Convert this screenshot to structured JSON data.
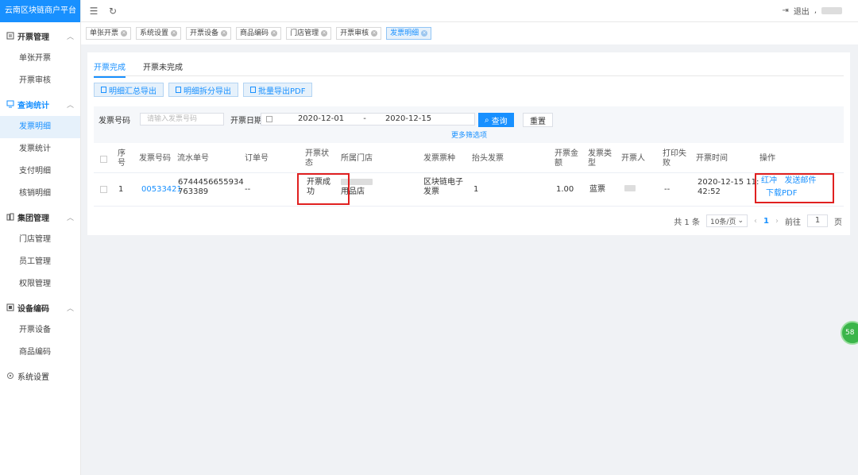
{
  "app": {
    "title": "云南区块链商户平台"
  },
  "sidebar": {
    "groups": [
      {
        "label": "开票管理",
        "icon": "invoice-icon",
        "items": [
          "单张开票",
          "开票审核"
        ]
      },
      {
        "label": "查询统计",
        "icon": "chart-icon",
        "items": [
          "发票明细",
          "发票统计",
          "支付明细",
          "核销明细"
        ],
        "active_item": "发票明细"
      },
      {
        "label": "集团管理",
        "icon": "group-icon",
        "items": [
          "门店管理",
          "员工管理",
          "权限管理"
        ]
      },
      {
        "label": "设备编码",
        "icon": "device-icon",
        "items": [
          "开票设备",
          "商品编码"
        ]
      },
      {
        "label": "系统设置",
        "icon": "gear-icon",
        "items": []
      }
    ]
  },
  "topbar": {
    "logout": "退出",
    "separator": ","
  },
  "tagbar": {
    "tags": [
      "单张开票",
      "系统设置",
      "开票设备",
      "商品编码",
      "门店管理",
      "开票审核",
      "发票明细"
    ],
    "active": "发票明细"
  },
  "tabs": [
    "开票完成",
    "开票未完成"
  ],
  "actions": {
    "export_summary": "明细汇总导出",
    "export_split": "明细拆分导出",
    "export_pdf": "批量导出PDF"
  },
  "filter": {
    "invoice_no_label": "发票号码",
    "invoice_no_placeholder": "请输入发票号码",
    "date_label": "开票日期",
    "date_start": "2020-12-01",
    "date_sep": "-",
    "date_end": "2020-12-15",
    "query": "查询",
    "reset": "重置",
    "more": "更多筛选项"
  },
  "table": {
    "headers": {
      "seq": [
        "序",
        "号"
      ],
      "invoice_no": "发票号码",
      "serial_no": "流水单号",
      "order_no": "订单号",
      "status": [
        "开票状",
        "态"
      ],
      "store": "所属门店",
      "kind": "发票票种",
      "title": "抬头发票",
      "amount": [
        "开票金",
        "额"
      ],
      "type": [
        "发票类",
        "型"
      ],
      "issuer": "开票人",
      "print_fail": [
        "打印失",
        "败"
      ],
      "time": "开票时间",
      "ops": "操作"
    },
    "rows": [
      {
        "seq": "1",
        "invoice_no": "00533421",
        "serial_no": [
          "6744456655934",
          "763389"
        ],
        "order_no": "--",
        "status": [
          "开票成",
          "功"
        ],
        "store_suffix": "用品店",
        "kind": [
          "区块链电子",
          "发票"
        ],
        "title": "1",
        "amount": "1.00",
        "type": "蓝票",
        "print_fail": "--",
        "time": [
          "2020-12-15 11:",
          "42:52"
        ],
        "ops": {
          "red": "红冲",
          "email": "发送邮件",
          "pdf": "下载PDF"
        }
      }
    ]
  },
  "pagination": {
    "total": "共 1 条",
    "page_size": "10条/页",
    "current": "1",
    "goto_label": "前往",
    "goto_value": "1",
    "page_unit": "页"
  },
  "badge": {
    "text": "58"
  }
}
